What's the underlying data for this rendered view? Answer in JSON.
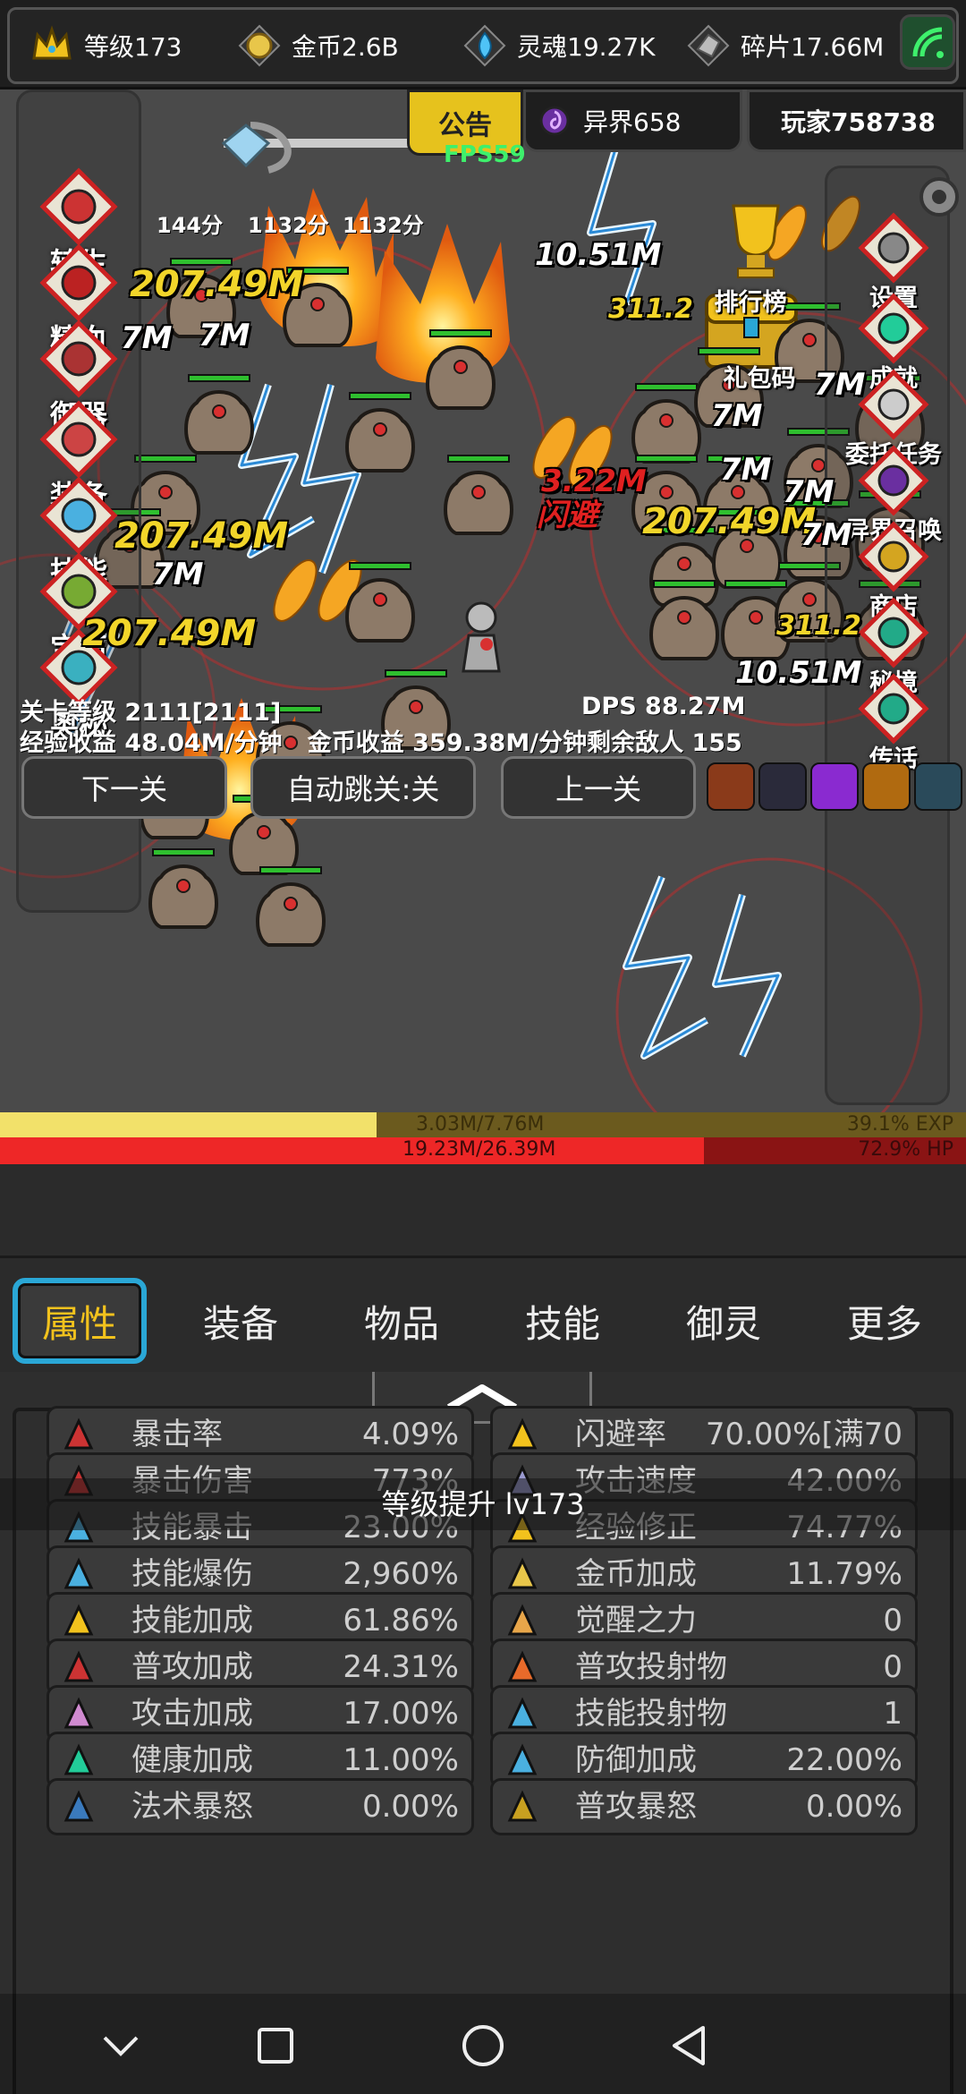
{
  "resources": {
    "level": "等级173",
    "gold": "金币2.6B",
    "soul": "灵魂19.27K",
    "fragment": "碎片17.66M"
  },
  "header": {
    "notice": "公告",
    "fps": "FPS59",
    "otherworld": "异界658",
    "player": "玩家758738"
  },
  "left_menu": [
    "转生",
    "精血",
    "御器",
    "装备",
    "技能",
    "宝石",
    "奥秘"
  ],
  "right_menu": [
    "设置",
    "排行榜",
    "礼包码",
    "成就",
    "委托任务",
    "异界召唤",
    "商店",
    "秘境",
    "传话"
  ],
  "score_labels": [
    "144分",
    "1132分",
    "1132分"
  ],
  "damage": {
    "d1": "207.49M",
    "d2": "10.51M",
    "d3": "311.2",
    "d4": "7M",
    "d5": "7M",
    "d6": "7M",
    "d7": "7M",
    "d8": "3.22M",
    "d9": "闪避",
    "d10": "7M",
    "d11": "207.49M",
    "d12": "207.49M",
    "d13": "7M",
    "d14": "7M",
    "d15": "7M",
    "d16": "207.49M",
    "d17": "311.2",
    "d18": "10.51M"
  },
  "stage": {
    "level_label": "关卡等级",
    "level_value": "2111[2111]",
    "dps": "DPS 88.27M",
    "exp_label": "经验收益",
    "exp_value": "48.04M/分钟",
    "gold_label": "金币收益",
    "gold_value": "359.38M/分钟",
    "enemies": "剩余敌人 155"
  },
  "buttons": {
    "next": "下一关",
    "auto": "自动跳关:关",
    "prev": "上一关"
  },
  "bars": {
    "exp_text": "3.03M/7.76M",
    "exp_pct": "39.1% EXP",
    "exp_fraction": 0.39,
    "hp_text": "19.23M/26.39M",
    "hp_pct": "72.9%  HP",
    "hp_fraction": 0.729
  },
  "tabs": [
    "属性",
    "装备",
    "物品",
    "技能",
    "御灵",
    "更多"
  ],
  "toast": "等级提升 lv173",
  "stats_left": [
    {
      "name": "暴击率",
      "value": "4.09%"
    },
    {
      "name": "暴击伤害",
      "value": "773%"
    },
    {
      "name": "技能暴击",
      "value": "23.00%"
    },
    {
      "name": "技能爆伤",
      "value": "2,960%"
    },
    {
      "name": "技能加成",
      "value": "61.86%"
    },
    {
      "name": "普攻加成",
      "value": "24.31%"
    },
    {
      "name": "攻击加成",
      "value": "17.00%"
    },
    {
      "name": "健康加成",
      "value": "11.00%"
    },
    {
      "name": "法术暴怒",
      "value": "0.00%"
    }
  ],
  "stats_right": [
    {
      "name": "闪避率",
      "value": "70.00%[满70"
    },
    {
      "name": "攻击速度",
      "value": "42.00%"
    },
    {
      "name": "经验修正",
      "value": "74.77%"
    },
    {
      "name": "金币加成",
      "value": "11.79%"
    },
    {
      "name": "觉醒之力",
      "value": "0"
    },
    {
      "name": "普攻投射物",
      "value": "0"
    },
    {
      "name": "技能投射物",
      "value": "1"
    },
    {
      "name": "防御加成",
      "value": "22.00%"
    },
    {
      "name": "普攻暴怒",
      "value": "0.00%"
    }
  ],
  "colors": {
    "accent_tab": "#2aa7d6",
    "active_tab_text": "#f2c21d",
    "exp_bar": "#f2e16a",
    "hp_bar": "#ee2727",
    "fps": "#3ef06c",
    "damage_yellow": "#f2d52a"
  },
  "icons": {
    "level": "crown-icon",
    "gold": "coin-icon",
    "soul": "soul-flame-icon",
    "fragment": "fragment-icon",
    "signal": "signal-icon"
  }
}
